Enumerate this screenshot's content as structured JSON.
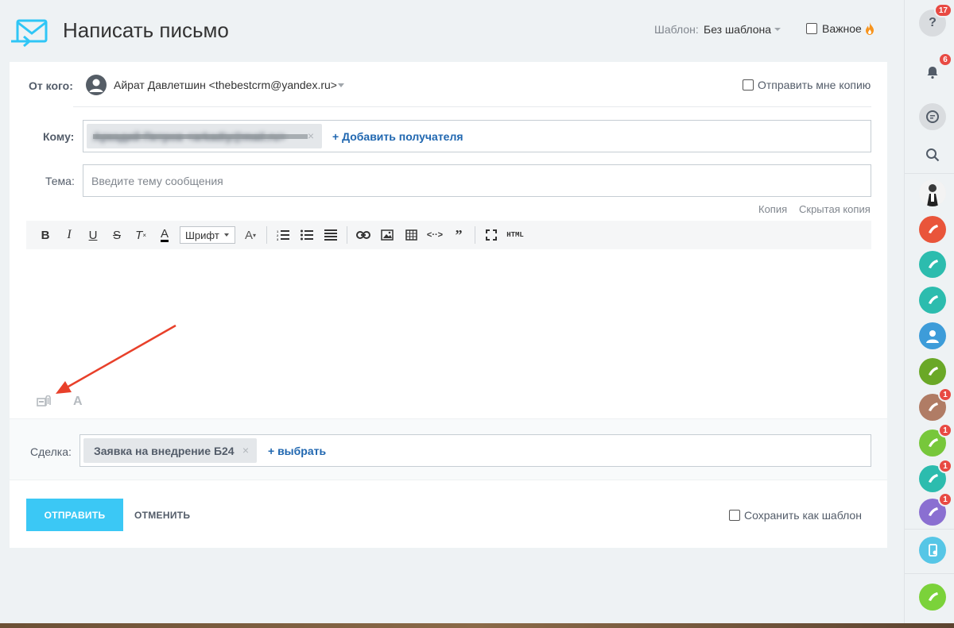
{
  "header": {
    "title": "Написать письмо",
    "template_label": "Шаблон:",
    "template_value": "Без шаблона",
    "important_label": "Важное"
  },
  "from": {
    "label": "От кого:",
    "value": "Айрат Давлетшин <thebestcrm@yandex.ru>",
    "send_copy_label": "Отправить мне копию"
  },
  "to": {
    "label": "Кому:",
    "recipient": "Аркадий Петров <arkadiy@mail.ru>",
    "add_label": "+ Добавить получателя"
  },
  "subject": {
    "label": "Тема:",
    "placeholder": "Введите тему сообщения",
    "value": ""
  },
  "cc": {
    "copy": "Копия",
    "bcc": "Скрытая копия"
  },
  "toolbar": {
    "bold": "B",
    "italic": "I",
    "underline": "U",
    "strike": "S",
    "clear": "T",
    "color": "A",
    "font": "Шрифт",
    "size": "A",
    "html": "HTML"
  },
  "editor": {
    "font_toggle": "A"
  },
  "deal": {
    "label": "Сделка:",
    "chip": "Заявка на внедрение Б24",
    "select_label": "+ выбрать"
  },
  "actions": {
    "send": "ОТПРАВИТЬ",
    "cancel": "ОТМЕНИТЬ",
    "save_template": "Сохранить как шаблон"
  },
  "sidebar": {
    "help_count": "17",
    "notifications_count": "6",
    "call_badges": [
      "1",
      "1",
      "1",
      "1"
    ]
  },
  "colors": {
    "accent": "#3bc8f5",
    "link": "#2067b0",
    "badge": "#e84a43",
    "arrow": "#e8402a"
  }
}
